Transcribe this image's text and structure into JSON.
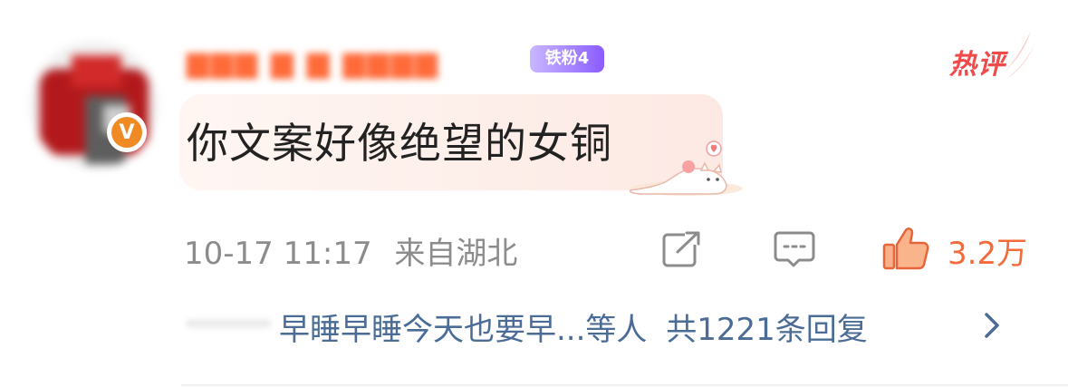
{
  "comment": {
    "username": "▆▆▆ ▆ ▆ ▆▆▆▆",
    "fan_badge": "铁粉4",
    "hot_label": "热评",
    "verified_badge": "V",
    "text": "你文案好像绝望的女铜",
    "timestamp": "10-17 11:17",
    "location": "来自湖北",
    "like_count": "3.2万",
    "replies_summary": "早睡早睡今天也要早...等人",
    "replies_total": "共1221条回复"
  },
  "icons": {
    "share": "share-icon",
    "reply": "comment-icon",
    "like": "thumbs-up-icon",
    "more": "chevron-right-icon"
  },
  "colors": {
    "accent_orange": "#f26b3a",
    "link_blue": "#4a6c96",
    "hot_red": "#f04a4a",
    "meta_gray": "#8c8c8c"
  }
}
